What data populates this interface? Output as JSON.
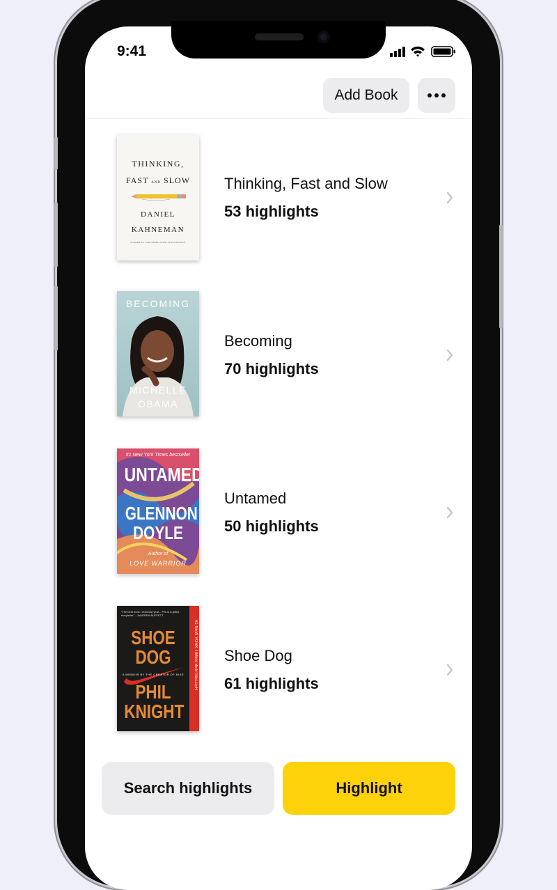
{
  "status_bar": {
    "time": "9:41"
  },
  "header": {
    "add_book_label": "Add Book",
    "more_icon": "ellipsis-icon"
  },
  "books": [
    {
      "title": "Thinking, Fast and Slow",
      "highlights": "53 highlights",
      "cover": {
        "line1": "THINKING,",
        "line2a": "FAST",
        "line2b": "AND",
        "line2c": "SLOW",
        "author1": "DANIEL",
        "author2": "KAHNEMAN",
        "tagline": "WINNER OF THE NOBEL PRIZE IN ECONOMICS"
      }
    },
    {
      "title": "Becoming",
      "highlights": "70 highlights",
      "cover": {
        "title": "BECOMING",
        "author1": "MICHELLE",
        "author2": "OBAMA"
      }
    },
    {
      "title": "Untamed",
      "highlights": "50 highlights",
      "cover": {
        "blurb": "#1 New York Times bestseller",
        "title": "UNTAMED",
        "author1": "GLENNON",
        "author2": "DOYLE",
        "byline": "Author of",
        "other": "LOVE WARRIOR"
      }
    },
    {
      "title": "Shoe Dog",
      "highlights": "61 highlights",
      "cover": {
        "quote": "“The best book I read last year... Phil is a gifted storyteller” —WARREN BUFFETT",
        "title1": "SHOE",
        "title2": "DOG",
        "subtitle": "A MEMOIR BY THE CREATOR OF NIKE",
        "author1": "PHIL",
        "author2": "KNIGHT",
        "spine": "#1 NEW YORK TIMES BESTSELLER"
      }
    }
  ],
  "footer": {
    "search_label": "Search highlights",
    "highlight_label": "Highlight"
  },
  "colors": {
    "accent": "#fdd20a",
    "button_gray": "#ececee"
  }
}
